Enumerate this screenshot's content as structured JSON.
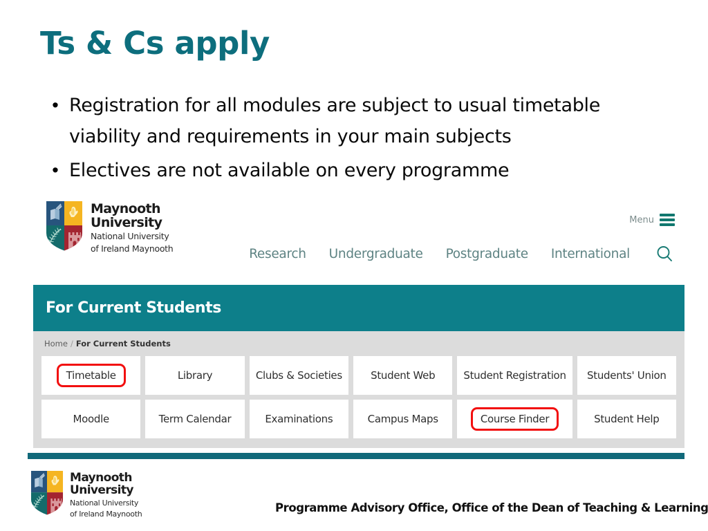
{
  "slide": {
    "title": "Ts & Cs apply",
    "title_color": "#0d6e7d",
    "bullets": [
      "Registration for all modules are subject to usual timetable viability and requirements in your main subjects",
      "Electives are not available on every programme"
    ],
    "bullet_marker": "•"
  },
  "website": {
    "logo": {
      "name_line1": "Maynooth",
      "name_line2": "University",
      "sub_line1": "National University",
      "sub_line2": "of Ireland Maynooth",
      "shield_colors": {
        "top_left": "#27547d",
        "top_right": "#f5b521",
        "bottom_left": "#146b6b",
        "bottom_right": "#a32430"
      }
    },
    "menu": {
      "label": "Menu",
      "icon": "hamburger-icon",
      "icon_color": "#10776e"
    },
    "nav": [
      {
        "label": "Research"
      },
      {
        "label": "Undergraduate"
      },
      {
        "label": "Postgraduate"
      },
      {
        "label": "International"
      }
    ],
    "search": {
      "icon": "search-icon",
      "color": "#177a73"
    },
    "banner": {
      "title": "For Current Students",
      "background": "#0d7f8a"
    },
    "breadcrumb": {
      "home": "Home",
      "separator": "/",
      "current": "For Current Students"
    },
    "tiles": [
      {
        "label": "Timetable",
        "highlighted": true
      },
      {
        "label": "Library",
        "highlighted": false
      },
      {
        "label": "Clubs & Societies",
        "highlighted": false
      },
      {
        "label": "Student Web",
        "highlighted": false
      },
      {
        "label": "Student Registration",
        "highlighted": false
      },
      {
        "label": "Students' Union",
        "highlighted": false
      },
      {
        "label": "Moodle",
        "highlighted": false
      },
      {
        "label": "Term Calendar",
        "highlighted": false
      },
      {
        "label": "Examinations",
        "highlighted": false
      },
      {
        "label": "Campus Maps",
        "highlighted": false
      },
      {
        "label": "Course Finder",
        "highlighted": true
      },
      {
        "label": "Student Help",
        "highlighted": false
      }
    ],
    "highlight_color": "#f20f0f"
  },
  "footer": {
    "rule_color": "#11697a",
    "caption": "Programme Advisory Office, Office of the Dean of Teaching & Learning",
    "logo": {
      "name_line1": "Maynooth",
      "name_line2": "University",
      "sub_line1": "National University",
      "sub_line2": "of Ireland Maynooth"
    }
  }
}
